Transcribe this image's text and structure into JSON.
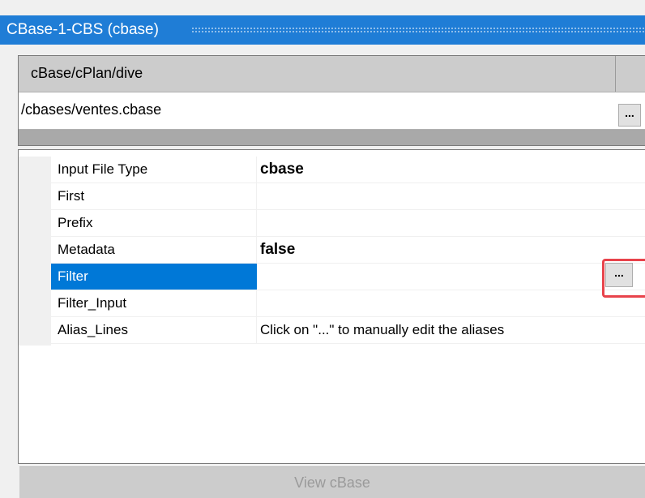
{
  "window": {
    "title": "CBase-1-CBS (cbase)"
  },
  "path_panel": {
    "header_label": "cBase/cPlan/dive",
    "path_value": "/cbases/ventes.cbase",
    "browse_label": "..."
  },
  "properties": [
    {
      "name": "Input File Type",
      "value": "cbase",
      "bold": true
    },
    {
      "name": "First",
      "value": ""
    },
    {
      "name": "Prefix",
      "value": ""
    },
    {
      "name": "Metadata",
      "value": "false",
      "bold": true
    },
    {
      "name": "Filter",
      "value": "",
      "selected": true
    },
    {
      "name": "Filter_Input",
      "value": ""
    },
    {
      "name": "Alias_Lines",
      "value": "Click on \"...\" to manually edit the aliases"
    }
  ],
  "filter_browse_label": "...",
  "view_button_label": "View cBase",
  "colors": {
    "titlebar": "#1f7dd6",
    "selection": "#0078d7",
    "highlight": "#e8434b"
  }
}
